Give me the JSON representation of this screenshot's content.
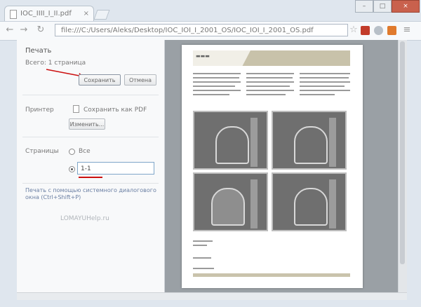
{
  "browser": {
    "tab_title": "IOC_IIII_I_II.pdf",
    "tab_close": "×",
    "address": "file:///C:/Users/Aleks/Desktop/IOC_IOI_I_2001_OS/IOC_IOI_I_2001_OS.pdf",
    "window_buttons": [
      "–",
      "□",
      "×"
    ]
  },
  "print_panel": {
    "title": "Печать",
    "total": "Всего: 1 страница",
    "save_button": "Сохранить",
    "cancel_button": "Отмена",
    "destination_label": "Принтер",
    "destination_value": "Сохранить как PDF",
    "change_button": "Изменить...",
    "pages_label": "Страницы",
    "pages_all": "Все",
    "pages_input_value": "1-1",
    "system_dialog_link": "Печать с помощью системного диалогового окна (Ctrl+Shift+P)",
    "watermark": "LOMAYUHelp.ru"
  },
  "annotations": {
    "accent": "#cc1010"
  },
  "icons": [
    "page-icon",
    "back-arrow-icon",
    "forward-arrow-icon",
    "reload-icon",
    "star-icon",
    "pdf-extension-icon",
    "settings-icon"
  ]
}
